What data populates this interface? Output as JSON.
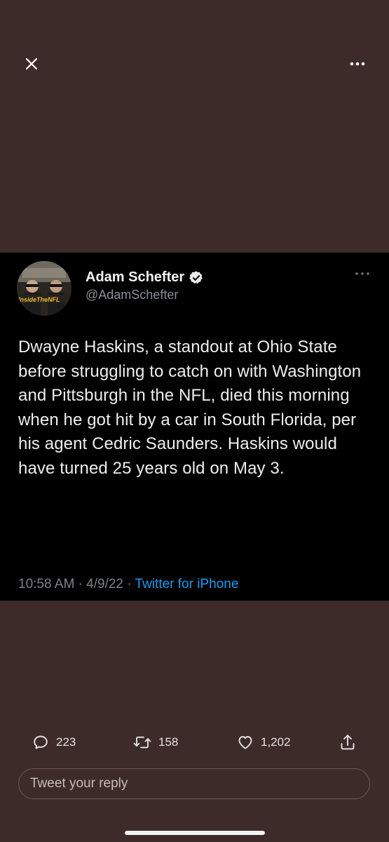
{
  "toolbar": {
    "close_icon": "close-icon",
    "more_icon": "more-horizontal-icon"
  },
  "tweet": {
    "author_name": "Adam Schefter",
    "author_handle": "@AdamSchefter",
    "verified": true,
    "avatar_caption": "Inside the NFL",
    "text": "Dwayne Haskins, a standout at Ohio State before struggling to catch on with Washington and Pittsburgh in the NFL, died this morning when he got hit by a car in South Florida, per his agent Cedric Saunders. Haskins would have turned 25 years old on May 3.",
    "time": "10:58 AM",
    "separator1": " · ",
    "date": "4/9/22",
    "separator2": " · ",
    "source": "Twitter for iPhone"
  },
  "actions": {
    "reply_count": "223",
    "retweet_count": "158",
    "like_count": "1,202"
  },
  "reply": {
    "placeholder": "Tweet your reply"
  },
  "colors": {
    "background": "#3c2b29",
    "card": "#000000",
    "link": "#1d9bf0",
    "verified": "#e8e8e8"
  }
}
